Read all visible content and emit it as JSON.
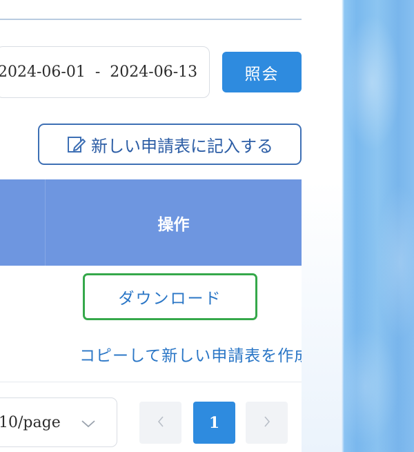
{
  "filters": {
    "date_start": "2024-06-01",
    "date_separator": "-",
    "date_end": "2024-06-13",
    "query_button": "照会"
  },
  "actions": {
    "new_application_button": "新しい申請表に記入する"
  },
  "table": {
    "columns": [
      "操作"
    ],
    "row_actions": {
      "download": "ダウンロード",
      "copy_new": "コピーして新しい申請表を作成"
    }
  },
  "pagination": {
    "page_size": "10/page",
    "current_page": "1"
  },
  "icons": {
    "edit": "edit-icon",
    "chevron_down": "chevron-down-icon",
    "prev": "chevron-left-icon",
    "next": "chevron-right-icon"
  },
  "colors": {
    "primary": "#2e8bdf",
    "table_header": "#6e96e0",
    "link": "#2a76c6",
    "highlight_border": "#35a84a"
  }
}
